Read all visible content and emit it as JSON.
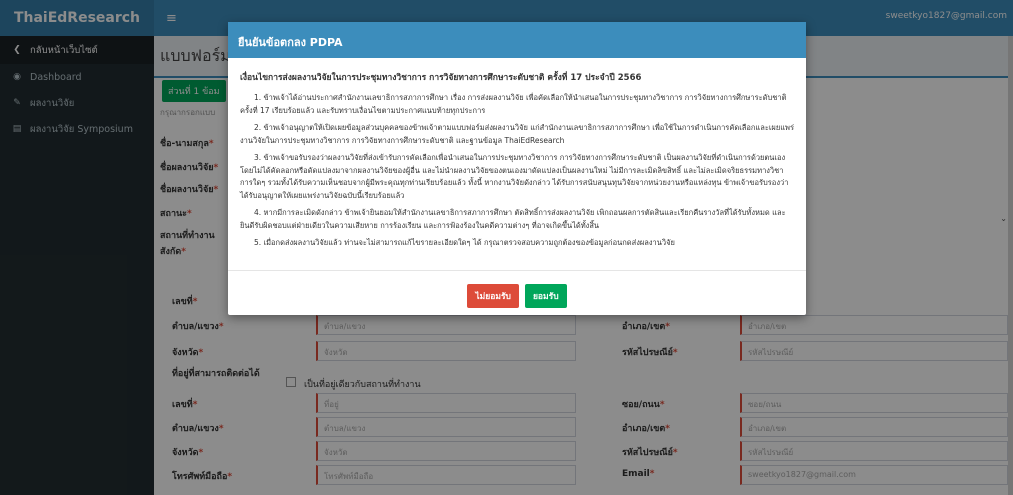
{
  "app": {
    "brand": "ThaiEdResearch",
    "user_email": "sweetkyo1827@gmail.com"
  },
  "sidebar": {
    "items": [
      {
        "label": "กลับหน้าเว็บไซต์",
        "icon": "chevron-left-icon"
      },
      {
        "label": "Dashboard",
        "icon": "dashboard-icon"
      },
      {
        "label": "ผลงานวิจัย",
        "icon": "pencil-icon"
      },
      {
        "label": "ผลงานวิจัย Symposium",
        "icon": "document-icon"
      }
    ]
  },
  "page": {
    "title": "แบบฟอร์ม",
    "tab_label": "ส่วนที่ 1 ข้อม",
    "hint": "กรุณากรอกแบบ"
  },
  "form": {
    "labels": {
      "name": "ชื่อ-นามสกุล",
      "research_th": "ชื่อผลงานวิจัย",
      "research_en": "ชื่อผลงานวิจัย",
      "status": "สถานะ",
      "workplace": "สถานที่ทำงาน",
      "affiliation": "สังกัด",
      "number": "เลขที่",
      "subdistrict": "ตำบล/แขวง",
      "district": "อำเภอ/เขต",
      "province": "จังหวัด",
      "postcode": "รหัสไปรษณีย์",
      "contact_address": "ที่อยู่ที่สามารถติดต่อได้",
      "same_as_work": "เป็นที่อยู่เดียวกับสถานที่ทำงาน",
      "soi": "ซอย/ถนน",
      "mobile": "โทรศัพท์มือถือ",
      "email": "Email"
    },
    "placeholders": {
      "subdistrict": "ตำบล/แขวง",
      "district": "อำเภอ/เขต",
      "province": "จังหวัด",
      "postcode": "รหัสไปรษณีย์",
      "number": "ที่อยู่",
      "soi": "ซอย/ถนน",
      "mobile": "โทรศัพท์มือถือ"
    },
    "values": {
      "email": "sweetkyo1827@gmail.com"
    },
    "required_mark": "*"
  },
  "modal": {
    "title": "ยืนยันข้อตกลง PDPA",
    "subtitle": "เงื่อนไขการส่งผลงานวิจัยในการประชุมทางวิชาการ การวิจัยทางการศึกษาระดับชาติ ครั้งที่ 17 ประจำปี 2566",
    "terms": [
      "1. ข้าพเจ้าได้อ่านประกาศสำนักงานเลขาธิการสภาการศึกษา เรื่อง การส่งผลงานวิจัย เพื่อคัดเลือกให้นำเสนอในการประชุมทางวิชาการ การวิจัยทางการศึกษาระดับชาติ ครั้งที่ 17 เรียบร้อยแล้ว และรับทราบเงื่อนไขตามประกาศแนบท้ายทุกประการ",
      "2. ข้าพเจ้าอนุญาตให้เปิดเผยข้อมูลส่วนบุคคลของข้าพเจ้าตามแบบฟอร์มส่งผลงานวิจัย แก่สำนักงานเลขาธิการสภาการศึกษา เพื่อใช้ในการดำเนินการคัดเลือกและเผยแพร่งานวิจัยในการประชุมทางวิชาการ การวิจัยทางการศึกษาระดับชาติ และฐานข้อมูล ThaiEdResearch",
      "3. ข้าพเจ้าขอรับรองว่าผลงานวิจัยที่ส่งเข้ารับการคัดเลือกเพื่อนำเสนอในการประชุมทางวิชาการ การวิจัยทางการศึกษาระดับชาติ เป็นผลงานวิจัยที่ดำเนินการด้วยตนเอง โดยไม่ได้คัดลอกหรือดัดแปลงมาจากผลงานวิจัยของผู้อื่น และไม่นำผลงานวิจัยของตนเองมาดัดแปลงเป็นผลงานใหม่ ไม่มีการละเมิดลิขสิทธิ์ และไม่ละเมิดจริยธรรมทางวิชาการใดๆ รวมทั้งได้รับความเห็นชอบจากผู้มีพระคุณทุกท่านเรียบร้อยแล้ว ทั้งนี้ หากงานวิจัยดังกล่าว ได้รับการสนับสนุนทุนวิจัยจากหน่วยงานหรือแหล่งทุน ข้าพเจ้าขอรับรองว่า ได้รับอนุญาตให้เผยแพร่งานวิจัยฉบับนี้เรียบร้อยแล้ว",
      "4. หากมีการละเมิดดังกล่าว ข้าพเจ้ายินยอมให้สำนักงานเลขาธิการสภาการศึกษา ตัดสิทธิ์การส่งผลงานวิจัย เพิกถอนผลการตัดสินและเรียกคืนรางวัลที่ได้รับทั้งหมด และยินดีรับผิดชอบแต่ฝ่ายเดียวในความเสียหาย การร้องเรียน และการฟ้องร้องในคดีความต่างๆ ที่อาจเกิดขึ้นได้ทั้งสิ้น",
      "5. เมื่อกดส่งผลงานวิจัยแล้ว ท่านจะไม่สามารถแก้ไขรายละเอียดใดๆ ได้ กรุณาตรวจสอบความถูกต้องของข้อมูลก่อนกดส่งผลงานวิจัย"
    ],
    "decline_label": "ไม่ยอมรับ",
    "accept_label": "ยอมรับ"
  },
  "colors": {
    "topbar": "#3c8dbc",
    "sidebar": "#222d32",
    "accept": "#00a65a",
    "decline": "#dd4b39"
  }
}
